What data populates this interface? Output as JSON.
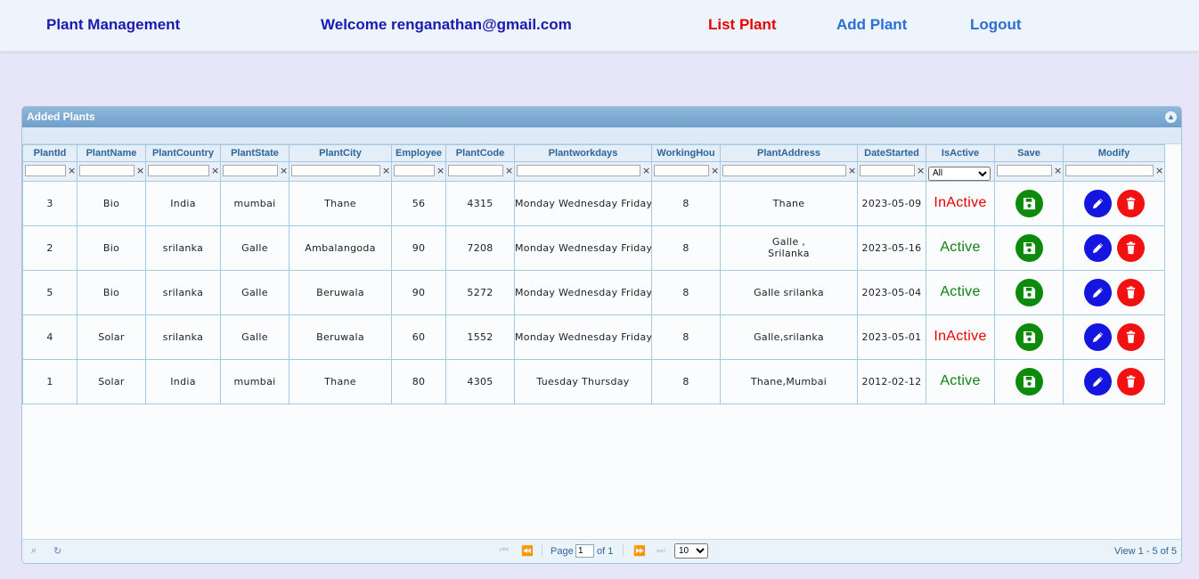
{
  "nav": {
    "brand": "Plant Management",
    "welcome": "Welcome renganathan@gmail.com",
    "list_plant": "List Plant",
    "add_plant": "Add Plant",
    "logout": "Logout"
  },
  "grid": {
    "caption": "Added Plants",
    "columns": [
      "PlantId",
      "PlantName",
      "PlantCountry",
      "PlantState",
      "PlantCity",
      "Employee",
      "PlantCode",
      "Plantworkdays",
      "WorkingHou",
      "PlantAddress",
      "DateStarted",
      "IsActive",
      "Save",
      "Modify"
    ],
    "isactive_filter": "All",
    "rows": [
      {
        "id": "3",
        "name": "Bio",
        "country": "India",
        "state": "mumbai",
        "city": "Thane",
        "employees": "56",
        "code": "4315",
        "workdays": "Monday  Wednesday  Friday",
        "hours": "8",
        "address": "Thane",
        "started": "2023-05-09",
        "active": "InActive"
      },
      {
        "id": "2",
        "name": "Bio",
        "country": "srilanka",
        "state": "Galle",
        "city": "Ambalangoda",
        "employees": "90",
        "code": "7208",
        "workdays": "Monday  Wednesday  Friday",
        "hours": "8",
        "address": "Galle ,\nSrilanka",
        "started": "2023-05-16",
        "active": "Active"
      },
      {
        "id": "5",
        "name": "Bio",
        "country": "srilanka",
        "state": "Galle",
        "city": "Beruwala",
        "employees": "90",
        "code": "5272",
        "workdays": "Monday  Wednesday  Friday",
        "hours": "8",
        "address": "Galle srilanka",
        "started": "2023-05-04",
        "active": "Active"
      },
      {
        "id": "4",
        "name": "Solar",
        "country": "srilanka",
        "state": "Galle",
        "city": "Beruwala",
        "employees": "60",
        "code": "1552",
        "workdays": "Monday  Wednesday  Friday",
        "hours": "8",
        "address": "Galle,srilanka",
        "started": "2023-05-01",
        "active": "InActive"
      },
      {
        "id": "1",
        "name": "Solar",
        "country": "India",
        "state": "mumbai",
        "city": "Thane",
        "employees": "80",
        "code": "4305",
        "workdays": "Tuesday  Thursday",
        "hours": "8",
        "address": "Thane,Mumbai",
        "started": "2012-02-12",
        "active": "Active"
      }
    ]
  },
  "pager": {
    "page_label": "Page",
    "page_value": "1",
    "of_label": "of 1",
    "page_size": "10",
    "view_text": "View 1 - 5 of 5"
  },
  "icons": {
    "search": "search-icon",
    "refresh": "refresh-icon",
    "save": "floppy-disk-icon",
    "edit": "pencil-icon",
    "delete": "trash-icon",
    "collapse": "collapse-icon"
  },
  "colors": {
    "inactive": "#e60000",
    "active": "#108010",
    "save_button": "#0c8a0c",
    "edit_button": "#1515e0",
    "delete_button": "#f21010"
  }
}
